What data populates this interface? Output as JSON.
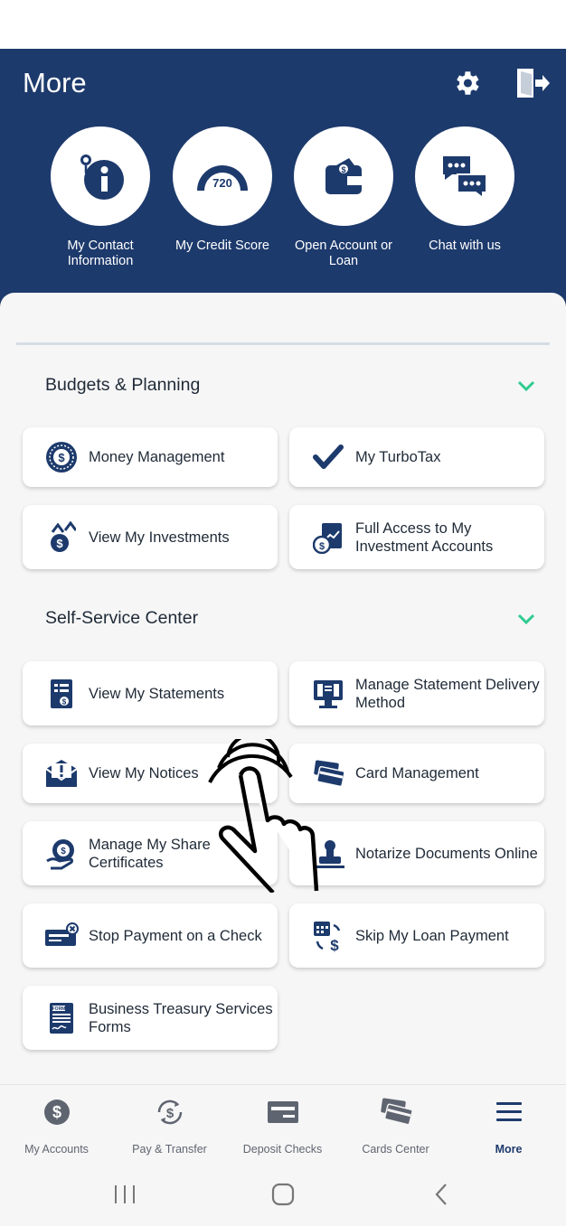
{
  "header": {
    "title": "More",
    "settings_icon": "gear-icon",
    "logout_icon": "logout-icon",
    "background": "#1d3a6c"
  },
  "quick_actions": [
    {
      "label": "My Contact Information",
      "icon": "contact-info-icon"
    },
    {
      "label": "My Credit Score",
      "icon": "credit-score-gauge-icon",
      "value": "720"
    },
    {
      "label": "Open Account or Loan",
      "icon": "wallet-icon"
    },
    {
      "label": "Chat with us",
      "icon": "chat-bubbles-icon"
    }
  ],
  "sections": [
    {
      "title": "Budgets & Planning",
      "expanded": true,
      "items": [
        {
          "label": "Money Management",
          "icon": "money-management-icon"
        },
        {
          "label": "My TurboTax",
          "icon": "checkmark-icon"
        },
        {
          "label": "View My Investments",
          "icon": "investments-icon"
        },
        {
          "label": "Full Access to My Investment Accounts",
          "icon": "investment-accounts-icon"
        }
      ]
    },
    {
      "title": "Self-Service Center",
      "expanded": true,
      "items": [
        {
          "label": "View My Statements",
          "icon": "statement-icon"
        },
        {
          "label": "Manage Statement Delivery Method",
          "icon": "statement-delivery-icon"
        },
        {
          "label": "View My Notices",
          "icon": "notice-envelope-icon"
        },
        {
          "label": "Card Management",
          "icon": "cards-icon"
        },
        {
          "label": "Manage My Share Certificates",
          "icon": "share-certificate-icon"
        },
        {
          "label": "Notarize Documents Online",
          "icon": "notary-stamp-icon"
        },
        {
          "label": "Stop Payment on a Check",
          "icon": "stop-check-icon"
        },
        {
          "label": "Skip My Loan Payment",
          "icon": "skip-payment-icon"
        },
        {
          "label": "Business Treasury Services Forms",
          "icon": "form-icon"
        }
      ]
    }
  ],
  "bottom_nav": [
    {
      "label": "My Accounts",
      "icon": "dollar-circle-icon",
      "active": false
    },
    {
      "label": "Pay & Transfer",
      "icon": "transfer-icon",
      "active": false
    },
    {
      "label": "Deposit Checks",
      "icon": "check-icon",
      "active": false
    },
    {
      "label": "Cards Center",
      "icon": "cards-stack-icon",
      "active": false
    },
    {
      "label": "More",
      "icon": "menu-icon",
      "active": true
    }
  ],
  "accent_color": "#2ecc8f"
}
